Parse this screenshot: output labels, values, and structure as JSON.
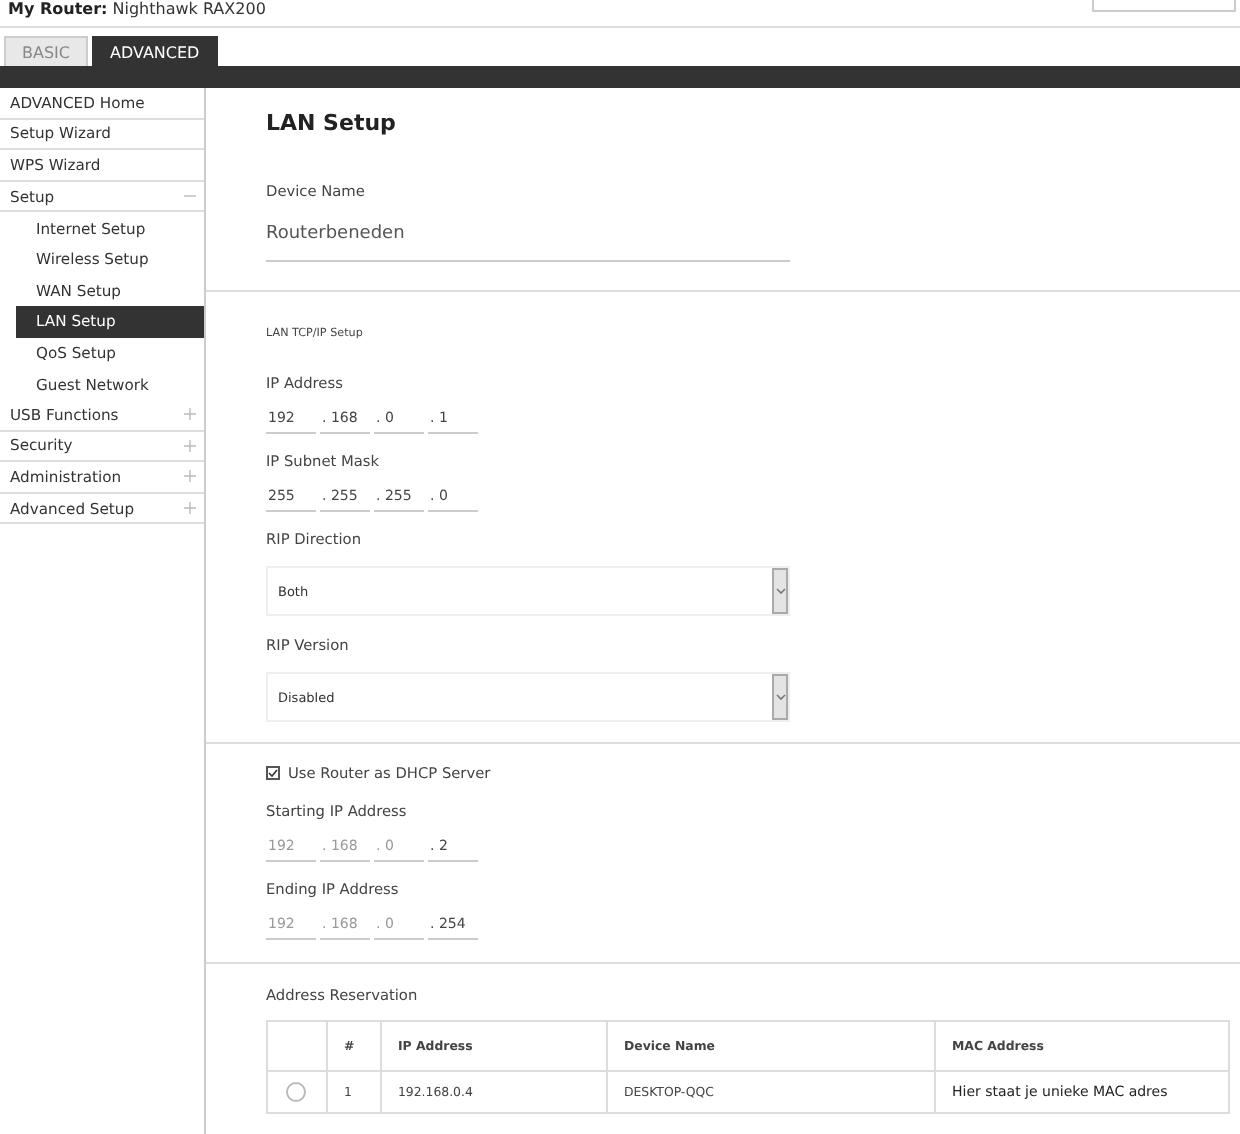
{
  "header": {
    "title_label": "My Router:",
    "title_value": "Nighthawk RAX200"
  },
  "tabs": [
    {
      "label": "BASIC",
      "selected": false
    },
    {
      "label": "ADVANCED",
      "selected": true
    }
  ],
  "sidebar": {
    "items": [
      {
        "label": "ADVANCED Home",
        "selected": false
      },
      {
        "label": "Setup Wizard",
        "selected": false
      },
      {
        "label": "WPS Wizard",
        "selected": false
      },
      {
        "label": "Setup",
        "selected": false,
        "expanded": true,
        "children": [
          {
            "label": "Internet Setup",
            "selected": false
          },
          {
            "label": "Wireless Setup",
            "selected": false
          },
          {
            "label": "WAN Setup",
            "selected": false
          },
          {
            "label": "LAN Setup",
            "selected": true
          },
          {
            "label": "QoS Setup",
            "selected": false
          },
          {
            "label": "Guest Network",
            "selected": false
          }
        ]
      },
      {
        "label": "USB Functions",
        "selected": false,
        "expanded": false
      },
      {
        "label": "Security",
        "selected": false,
        "expanded": false
      },
      {
        "label": "Administration",
        "selected": false,
        "expanded": false
      },
      {
        "label": "Advanced Setup",
        "selected": false,
        "expanded": false
      }
    ]
  },
  "page": {
    "title": "LAN Setup",
    "device_name": {
      "label": "Device Name",
      "value": "Routerbeneden"
    },
    "section_title": "LAN TCP/IP Setup",
    "ip_address": {
      "label": "IP Address",
      "octets": [
        {
          "value": "192",
          "disabled": false
        },
        {
          "dot": ".",
          "value": "168",
          "disabled": false
        },
        {
          "dot": ".",
          "value": "0",
          "disabled": false
        },
        {
          "dot": ".",
          "value": "1",
          "disabled": false
        }
      ]
    },
    "subnet_mask": {
      "label": "IP Subnet Mask",
      "octets": [
        {
          "value": "255",
          "disabled": false
        },
        {
          "dot": ".",
          "value": "255",
          "disabled": false
        },
        {
          "dot": ".",
          "value": "255",
          "disabled": false
        },
        {
          "dot": ".",
          "value": "0",
          "disabled": false
        }
      ]
    },
    "rip_direction": {
      "label": "RIP Direction",
      "value": "Both"
    },
    "rip_version": {
      "label": "RIP Version",
      "value": "Disabled"
    },
    "dhcp": {
      "label": "Use Router as DHCP Server",
      "checked": true
    },
    "start_ip": {
      "label": "Starting IP Address",
      "octets": [
        {
          "value": "192",
          "disabled": true
        },
        {
          "dot": ".",
          "value": "168",
          "disabled": true
        },
        {
          "dot": ".",
          "value": "0",
          "disabled": true
        },
        {
          "dot": ".",
          "value": "2",
          "disabled": false
        }
      ]
    },
    "end_ip": {
      "label": "Ending IP Address",
      "octets": [
        {
          "value": "192",
          "disabled": true
        },
        {
          "dot": ".",
          "value": "168",
          "disabled": true
        },
        {
          "dot": ".",
          "value": "0",
          "disabled": true
        },
        {
          "dot": ".",
          "value": "254",
          "disabled": false
        }
      ]
    },
    "reservation": {
      "title": "Address Reservation",
      "columns": [
        "#",
        "IP Address",
        "Device Name",
        "MAC Address"
      ],
      "rows": [
        {
          "selected": false,
          "cells": [
            "1",
            "192.168.0.4",
            "DESKTOP-QQC",
            "Hier staat je unieke MAC adres"
          ]
        }
      ]
    }
  }
}
